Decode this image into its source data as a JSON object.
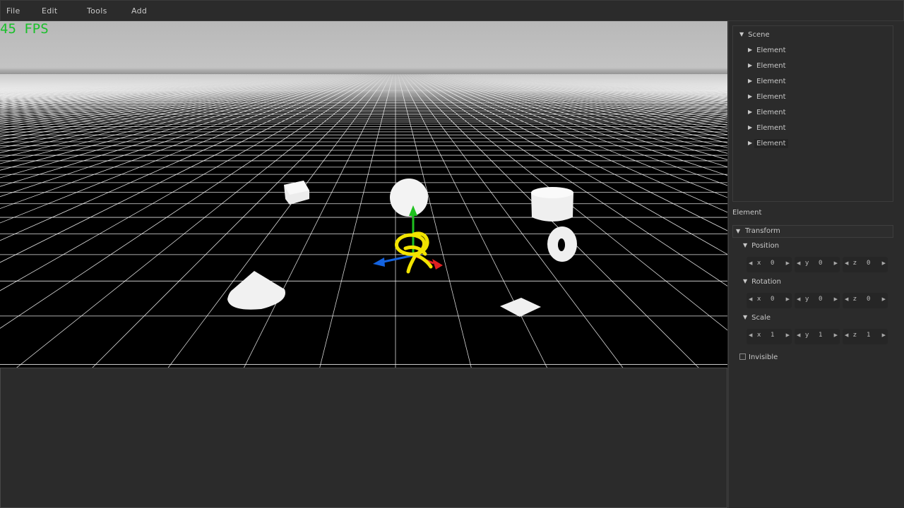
{
  "menu": {
    "file": "File",
    "edit": "Edit",
    "tools": "Tools",
    "add": "Add"
  },
  "viewport": {
    "fps": "45 FPS"
  },
  "scene_tree": {
    "root": "Scene",
    "items": [
      "Element",
      "Element",
      "Element",
      "Element",
      "Element",
      "Element",
      "Element"
    ]
  },
  "inspector": {
    "title": "Element",
    "transform": "Transform",
    "position": {
      "label": "Position",
      "x": "0",
      "y": "0",
      "z": "0"
    },
    "rotation": {
      "label": "Rotation",
      "x": "0",
      "y": "0",
      "z": "0"
    },
    "scale": {
      "label": "Scale",
      "x": "1",
      "y": "1",
      "z": "1"
    },
    "axis_x": "x",
    "axis_y": "y",
    "axis_z": "z",
    "invisible_label": "Invisible",
    "invisible_checked": false
  },
  "icons": {
    "expanded": "triangle-down-icon",
    "collapsed": "triangle-right-icon",
    "decrement": "arrow-left-icon",
    "increment": "arrow-right-icon"
  },
  "colors": {
    "fps": "#19c02a",
    "gizmo_x": "#e02121",
    "gizmo_y": "#1fc11f",
    "gizmo_z": "#1463e0",
    "selection": "#f2e400"
  }
}
